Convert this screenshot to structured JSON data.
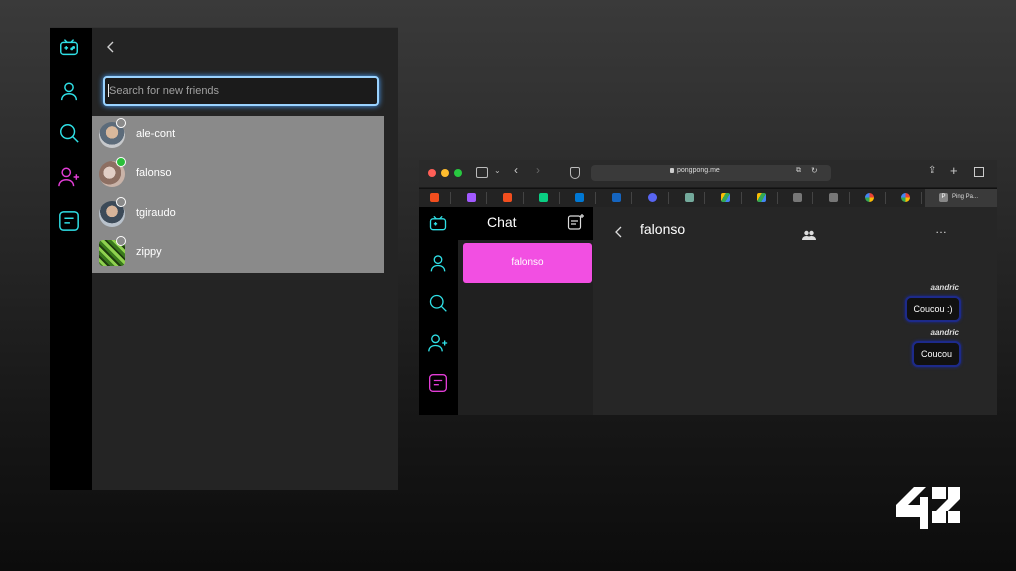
{
  "left_app": {
    "search": {
      "placeholder": "Search for new friends",
      "value": ""
    },
    "friends": [
      {
        "name": "ale-cont",
        "status": "offline"
      },
      {
        "name": "falonso",
        "status": "online"
      },
      {
        "name": "tgiraudo",
        "status": "offline"
      },
      {
        "name": "zippy",
        "status": "offline"
      }
    ],
    "sidebar_icons": [
      "game-controller-icon",
      "profile-icon",
      "search-icon",
      "add-friend-icon",
      "chat-icon"
    ]
  },
  "browser": {
    "url": "pongpong.me",
    "active_tab": "Ping Pa...",
    "active_tab_badge": "P"
  },
  "chat_app": {
    "chat_title": "Chat",
    "chats": [
      {
        "name": "falonso"
      }
    ],
    "conversation": {
      "title": "falonso",
      "messages": [
        {
          "author": "aandric",
          "text": "Coucou :)"
        },
        {
          "author": "aandric",
          "text": "Coucou"
        }
      ]
    }
  },
  "colors": {
    "accent_cyan": "#2fe0e6",
    "accent_magenta": "#e23dd6",
    "chat_item": "#f24fe2",
    "online": "#2bbf3a",
    "bubble_border": "#1d2a8a"
  },
  "logo": "42"
}
